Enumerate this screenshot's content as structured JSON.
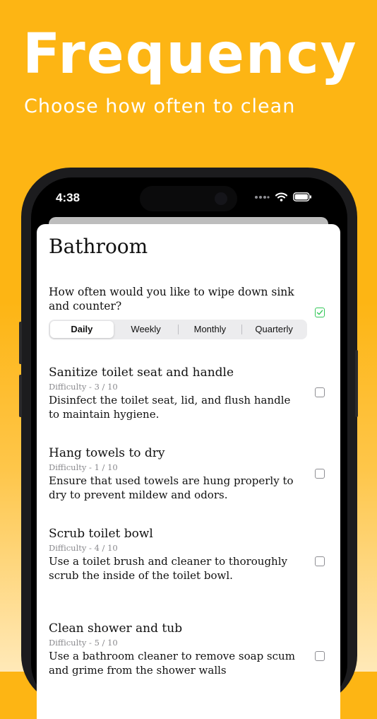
{
  "hero": {
    "title": "Frequency",
    "subtitle": "Choose how often to clean"
  },
  "status_bar": {
    "time": "4:38",
    "icons": [
      "signal-dots-icon",
      "wifi-icon",
      "battery-icon"
    ]
  },
  "sheet": {
    "title": "Bathroom",
    "question": "How often would you like to wipe down sink and counter?",
    "question_checked": true,
    "frequency_options": [
      "Daily",
      "Weekly",
      "Monthly",
      "Quarterly"
    ],
    "selected_frequency": "Daily",
    "tasks": [
      {
        "title": "Sanitize toilet seat and handle",
        "difficulty": "Difficulty -   3 / 10",
        "description": "Disinfect the toilet seat, lid, and flush handle to maintain hygiene.",
        "checked": false
      },
      {
        "title": "Hang towels to dry",
        "difficulty": "Difficulty -   1 / 10",
        "description": "Ensure that used towels are hung properly to dry to prevent mildew and odors.",
        "checked": false
      },
      {
        "title": "Scrub toilet bowl",
        "difficulty": "Difficulty -   4 / 10",
        "description": "Use a toilet brush and cleaner to thoroughly scrub the inside of the toilet bowl.",
        "checked": false
      },
      {
        "title": "Clean shower and tub",
        "difficulty": "Difficulty -   5 / 10",
        "description": "Use a bathroom cleaner to remove soap scum and grime from the shower walls",
        "checked": false
      }
    ]
  },
  "colors": {
    "background": "#FDB514",
    "check_green": "#34c759"
  }
}
